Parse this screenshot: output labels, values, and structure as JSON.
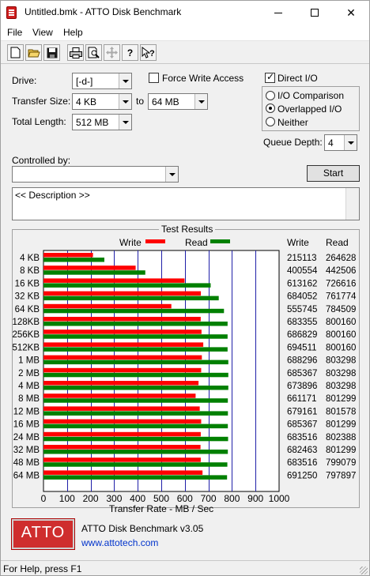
{
  "window": {
    "title": "Untitled.bmk - ATTO Disk Benchmark"
  },
  "menu": {
    "items": [
      "File",
      "View",
      "Help"
    ]
  },
  "toolbar": {
    "buttons": [
      "new-icon",
      "open-icon",
      "save-icon",
      "print-icon",
      "print-preview-icon",
      "move-icon",
      "help-icon",
      "context-help-icon"
    ]
  },
  "drive": {
    "label": "Drive:",
    "value": "[-d-]"
  },
  "force_write": {
    "label": "Force Write Access",
    "checked": false
  },
  "direct_io": {
    "label": "Direct I/O",
    "checked": true
  },
  "io_mode": {
    "options": [
      "I/O Comparison",
      "Overlapped I/O",
      "Neither"
    ],
    "selected": "Overlapped I/O"
  },
  "transfer_size": {
    "label": "Transfer Size:",
    "from": "4 KB",
    "to_label": "to",
    "to": "64 MB"
  },
  "total_length": {
    "label": "Total Length:",
    "value": "512 MB"
  },
  "queue_depth": {
    "label": "Queue Depth:",
    "value": "4"
  },
  "controlled_by": {
    "label": "Controlled by:",
    "value": ""
  },
  "start_button": {
    "label": "Start"
  },
  "description": {
    "text": "<< Description >>"
  },
  "results": {
    "title": "Test Results",
    "legend_write": "Write",
    "legend_read": "Read",
    "col_write": "Write",
    "col_read": "Read",
    "xlabel": "Transfer Rate - MB / Sec",
    "write_color": "#ff0000",
    "read_color": "#008000"
  },
  "chart_data": {
    "type": "bar",
    "orientation": "horizontal",
    "title": "Test Results",
    "xlabel": "Transfer Rate - MB / Sec",
    "xlim": [
      0,
      1000
    ],
    "xticks": [
      0,
      100,
      200,
      300,
      400,
      500,
      600,
      700,
      800,
      900,
      1000
    ],
    "categories": [
      "4 KB",
      "8 KB",
      "16 KB",
      "32 KB",
      "64 KB",
      "128KB",
      "256KB",
      "512KB",
      "1 MB",
      "2 MB",
      "4 MB",
      "8 MB",
      "12 MB",
      "16 MB",
      "24 MB",
      "32 MB",
      "48 MB",
      "64 MB"
    ],
    "series": [
      {
        "name": "Write",
        "color": "#ff0000",
        "values_kb": [
          "215113",
          "400554",
          "613162",
          "684052",
          "555745",
          "683355",
          "686829",
          "694511",
          "688296",
          "685367",
          "673896",
          "661171",
          "679161",
          "685367",
          "683516",
          "682463",
          "683516",
          "691250"
        ],
        "values": [
          210.1,
          391.2,
          598.8,
          668.0,
          542.7,
          667.3,
          670.7,
          678.2,
          672.2,
          669.3,
          658.1,
          645.7,
          663.2,
          669.3,
          667.5,
          666.5,
          667.5,
          675.0
        ]
      },
      {
        "name": "Read",
        "color": "#008000",
        "values_kb": [
          "264628",
          "442506",
          "726616",
          "761774",
          "784509",
          "800160",
          "800160",
          "800160",
          "803298",
          "803298",
          "803298",
          "801299",
          "801578",
          "801299",
          "802388",
          "801299",
          "799079",
          "797897"
        ],
        "values": [
          258.4,
          432.1,
          709.6,
          743.9,
          766.1,
          781.4,
          781.4,
          781.4,
          784.5,
          784.5,
          784.5,
          782.5,
          782.8,
          782.5,
          783.6,
          782.5,
          780.4,
          779.2
        ]
      }
    ]
  },
  "about": {
    "logo": "ATTO",
    "name": "ATTO Disk Benchmark v3.05",
    "url": "www.attotech.com"
  },
  "status": {
    "text": "For Help, press F1"
  }
}
